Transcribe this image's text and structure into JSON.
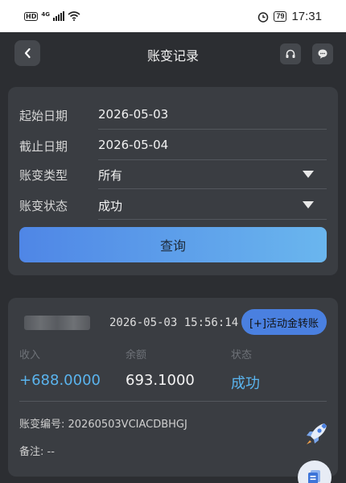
{
  "status_bar": {
    "hd": "HD",
    "network": "4G",
    "battery": "79",
    "time": "17:31"
  },
  "header": {
    "title": "账变记录"
  },
  "filters": {
    "start_date_label": "起始日期",
    "start_date_value": "2026-05-03",
    "end_date_label": "截止日期",
    "end_date_value": "2026-05-04",
    "type_label": "账变类型",
    "type_value": "所有",
    "status_label": "账变状态",
    "status_value": "成功",
    "query_button": "查询"
  },
  "record": {
    "datetime": "2026-05-03 15:56:14",
    "type_tag": "[+]活动金转账",
    "income_label": "收入",
    "income_value": "+688.0000",
    "balance_label": "余额",
    "balance_value": "693.1000",
    "status_label": "状态",
    "status_value": "成功",
    "id_label": "账变编号: ",
    "id_value": "20260503VCIACDBHGJ",
    "note_label": "备注: ",
    "note_value": "--"
  },
  "colors": {
    "background": "#2c2e32",
    "panel": "#3a3d42",
    "accent_blue": "#4a80e0",
    "income_color": "#5ab4ee",
    "status_color": "#5ab4ee"
  },
  "icons": [
    "hd-icon",
    "signal-icon",
    "wifi-icon",
    "alarm-icon",
    "battery-icon",
    "back-arrow-icon",
    "headset-icon",
    "chat-icon",
    "dropdown-triangle-icon",
    "rocket-icon",
    "document-icon"
  ]
}
